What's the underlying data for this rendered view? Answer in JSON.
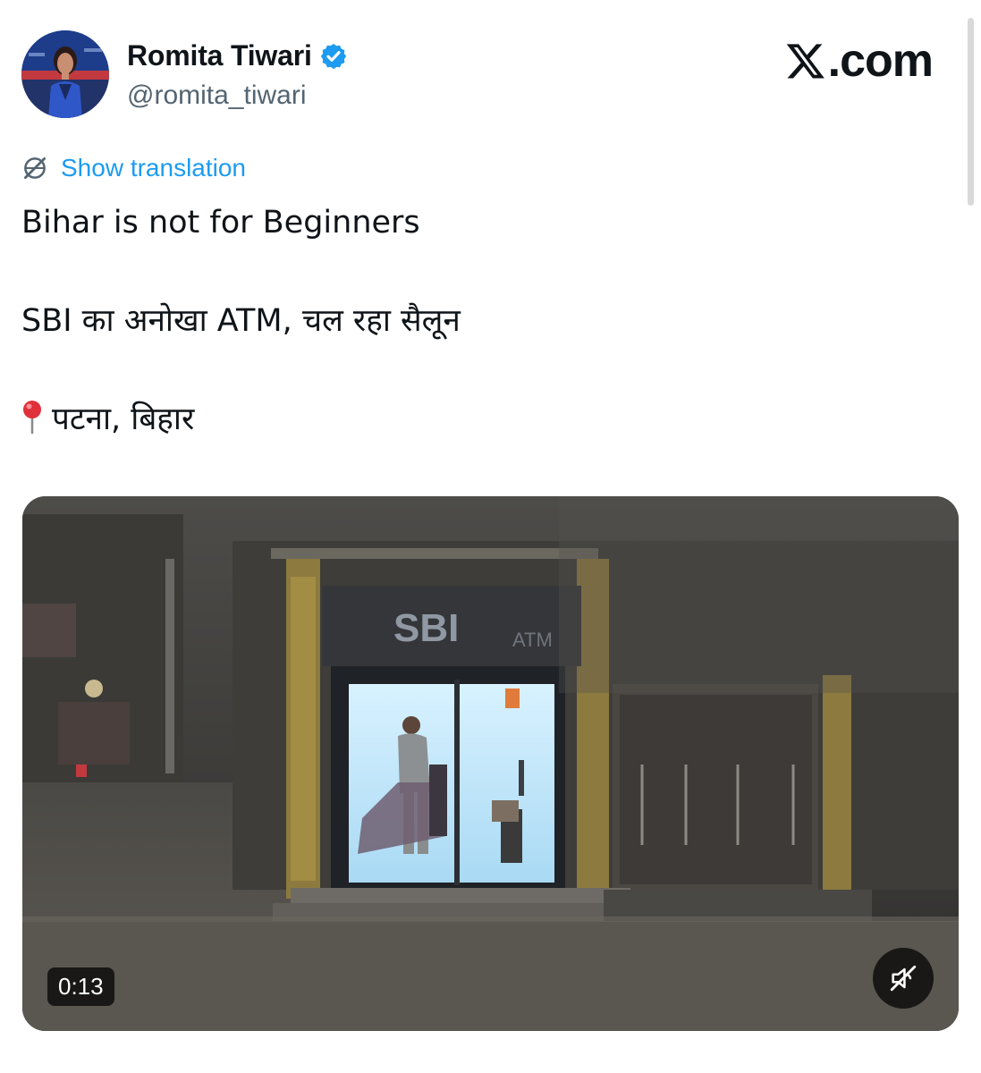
{
  "author": {
    "display_name": "Romita Tiwari",
    "handle": "@romita_tiwari",
    "verified": true
  },
  "brand": {
    "watermark": ".com",
    "accent_color": "#1d9bf0"
  },
  "translate": {
    "label": "Show translation",
    "icon": "globe-slash-icon"
  },
  "tweet": {
    "line1": "Bihar is not for Beginners",
    "line2": "SBI का अनोखा ATM, चल रहा सैलून",
    "line3": "पटना, बिहार",
    "line3_icon": "round-pushpin-icon"
  },
  "video": {
    "duration": "0:13",
    "sign_text": "SBI",
    "sign_subtext": "ATM",
    "mute_icon": "speaker-muted-icon"
  }
}
